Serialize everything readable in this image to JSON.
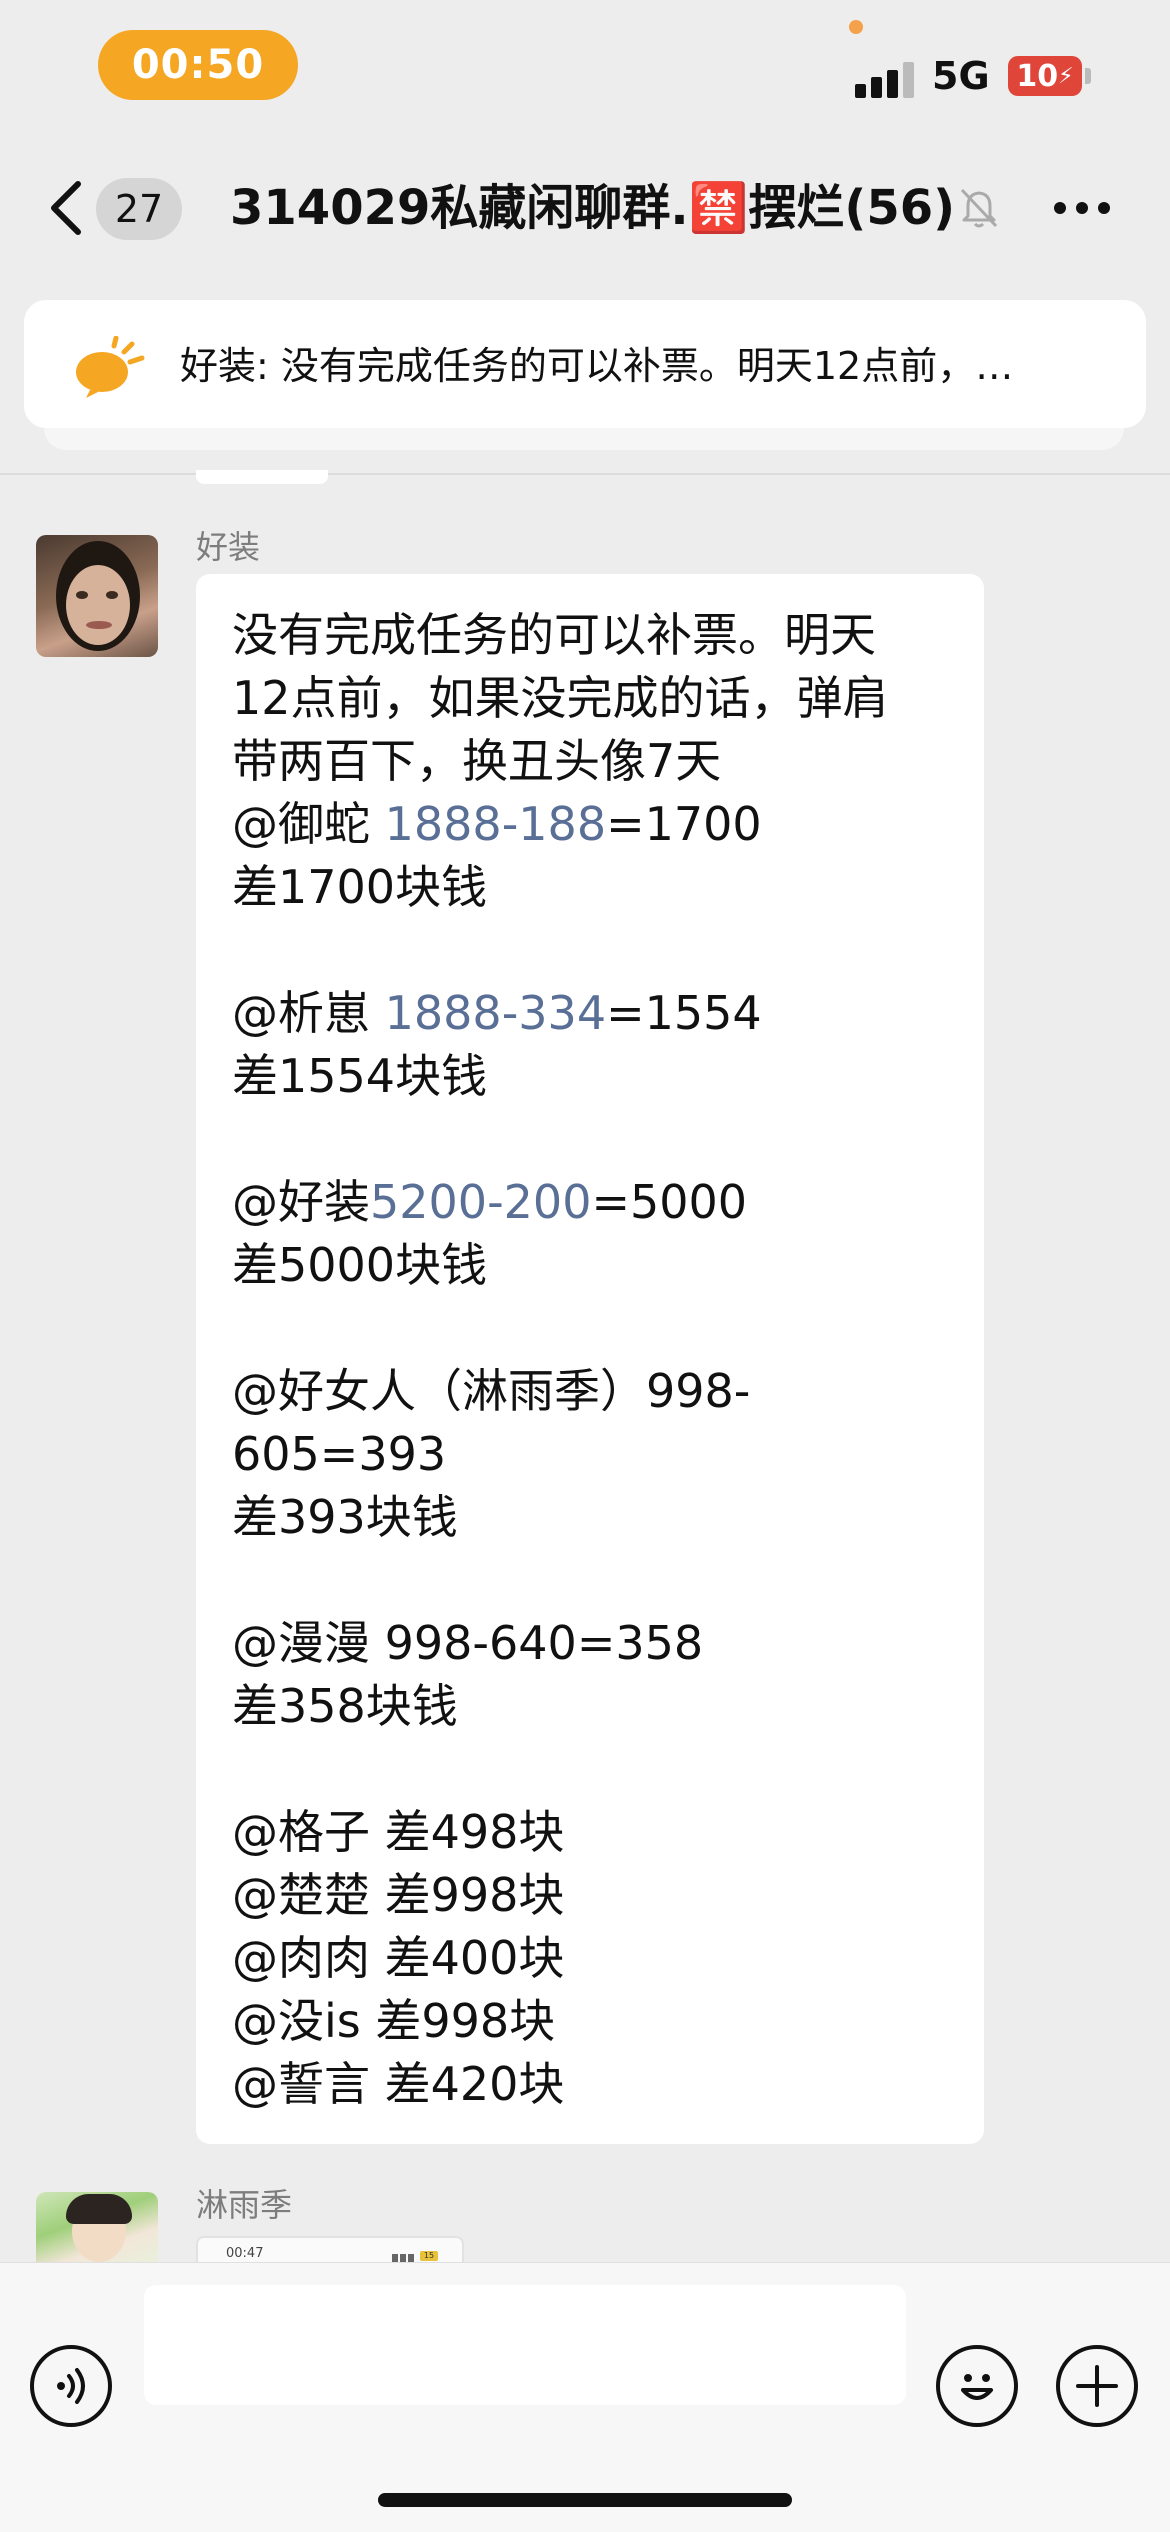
{
  "status_bar": {
    "time": "00:50",
    "network": "5G",
    "battery": "10",
    "colors": {
      "time_pill": "#f5a623",
      "battery": "#e0453a"
    }
  },
  "nav": {
    "unread_count": "27",
    "title": "314029私藏闲聊群.🈲摆烂(56)",
    "icons": [
      "back-chevron-icon",
      "mute-bell-icon",
      "more-icon"
    ]
  },
  "pinned": {
    "text": "好装: 没有完成任务的可以补票。明天12点前，…",
    "icon": "announcement-speaker-icon"
  },
  "messages": [
    {
      "sender": "好装",
      "lines": [
        {
          "parts": [
            {
              "t": "没有完成任务的可以补票。明天"
            }
          ]
        },
        {
          "parts": [
            {
              "t": "12点前，如果没完成的话，弹肩"
            }
          ]
        },
        {
          "parts": [
            {
              "t": "带两百下，换丑头像7天"
            }
          ]
        },
        {
          "parts": [
            {
              "t": "@御蛇 "
            },
            {
              "t": "1888-188",
              "link": true
            },
            {
              "t": "=1700"
            }
          ]
        },
        {
          "parts": [
            {
              "t": "差1700块钱"
            }
          ]
        },
        {
          "gap": true
        },
        {
          "parts": [
            {
              "t": "@析崽 "
            },
            {
              "t": "1888-334",
              "link": true
            },
            {
              "t": "=1554"
            }
          ]
        },
        {
          "parts": [
            {
              "t": "差1554块钱"
            }
          ]
        },
        {
          "gap": true
        },
        {
          "parts": [
            {
              "t": "@好装"
            },
            {
              "t": "5200-200",
              "link": true
            },
            {
              "t": "=5000"
            }
          ]
        },
        {
          "parts": [
            {
              "t": "差5000块钱"
            }
          ]
        },
        {
          "gap": true
        },
        {
          "parts": [
            {
              "t": "@好女人（淋雨季）998-"
            }
          ]
        },
        {
          "parts": [
            {
              "t": "605=393"
            }
          ]
        },
        {
          "parts": [
            {
              "t": "差393块钱"
            }
          ]
        },
        {
          "gap": true
        },
        {
          "parts": [
            {
              "t": "@漫漫 998-640=358"
            }
          ]
        },
        {
          "parts": [
            {
              "t": "差358块钱"
            }
          ]
        },
        {
          "gap": true
        },
        {
          "parts": [
            {
              "t": "@格子 差498块"
            }
          ]
        },
        {
          "parts": [
            {
              "t": "@楚楚 差998块"
            }
          ]
        },
        {
          "parts": [
            {
              "t": "@肉肉 差400块"
            }
          ]
        },
        {
          "parts": [
            {
              "t": "@没is 差998块"
            }
          ]
        },
        {
          "parts": [
            {
              "t": "@誓言 差420块"
            }
          ]
        }
      ]
    },
    {
      "sender": "淋雨季",
      "thumbnail_time": "00:47",
      "thumbnail_battery": "15"
    }
  ],
  "input": {
    "placeholder": "",
    "icons": [
      "voice-icon",
      "emoji-icon",
      "plus-icon"
    ]
  }
}
